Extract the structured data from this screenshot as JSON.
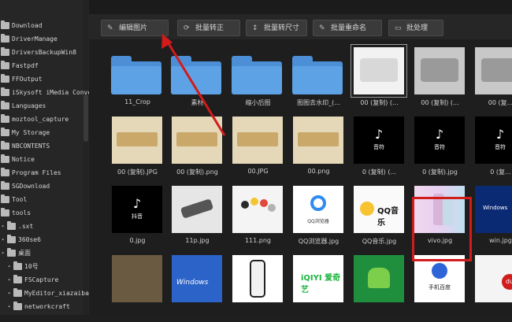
{
  "sidebar": {
    "items": [
      {
        "label": "Download",
        "indent": 0
      },
      {
        "label": "DriverManage",
        "indent": 0
      },
      {
        "label": "DriversBackupWin8",
        "indent": 0
      },
      {
        "label": "Fastpdf",
        "indent": 0
      },
      {
        "label": "FFOutput",
        "indent": 0
      },
      {
        "label": "iSkysoft iMedia Conve",
        "indent": 0
      },
      {
        "label": "Languages",
        "indent": 0
      },
      {
        "label": "moztool_capture",
        "indent": 0
      },
      {
        "label": "My Storage",
        "indent": 0
      },
      {
        "label": "NBCONTENTS",
        "indent": 0
      },
      {
        "label": "Notice",
        "indent": 0
      },
      {
        "label": "Program Files",
        "indent": 0
      },
      {
        "label": "SGDownload",
        "indent": 0
      },
      {
        "label": "Tool",
        "indent": 0
      },
      {
        "label": "tools",
        "indent": 0
      },
      {
        "label": ".sxt",
        "indent": 1
      },
      {
        "label": "360se6",
        "indent": 1
      },
      {
        "label": "桌面",
        "indent": 1
      },
      {
        "label": "10号",
        "indent": 2
      },
      {
        "label": "FSCapture",
        "indent": 2
      },
      {
        "label": "MyEditor_xiazaiba",
        "indent": 2
      },
      {
        "label": "networkcraft",
        "indent": 2
      }
    ]
  },
  "toolbar": {
    "buttons": [
      {
        "label": "编辑图片",
        "icon": "pencil-icon"
      },
      {
        "label": "批量转正",
        "icon": "rotate-icon"
      },
      {
        "label": "批量转尺寸",
        "icon": "resize-icon"
      },
      {
        "label": "批量重命名",
        "icon": "rename-icon"
      },
      {
        "label": "批处理",
        "icon": "batch-icon"
      }
    ]
  },
  "grid": {
    "rows": [
      [
        {
          "caption": "11_Crop",
          "kind": "folder"
        },
        {
          "caption": "素材",
          "kind": "folder"
        },
        {
          "caption": "缩小后图",
          "kind": "folder"
        },
        {
          "caption": "图图去水印_(...",
          "kind": "folder"
        },
        {
          "caption": "00 (复制) (...",
          "kind": "pub-w",
          "selected": true
        },
        {
          "caption": "00 (复制) (...",
          "kind": "pub"
        },
        {
          "caption": "00 (复...",
          "kind": "pub"
        }
      ],
      [
        {
          "caption": "00 (复制).JPG",
          "kind": "banner"
        },
        {
          "caption": "00 (复制).png",
          "kind": "banner"
        },
        {
          "caption": "00.JPG",
          "kind": "banner"
        },
        {
          "caption": "00.png",
          "kind": "banner"
        },
        {
          "caption": "0 (复制) (...",
          "kind": "tiktok",
          "tiktok_text": "音符"
        },
        {
          "caption": "0 (复制).jpg",
          "kind": "tiktok",
          "tiktok_text": "音符"
        },
        {
          "caption": "0 (复...",
          "kind": "tiktok",
          "tiktok_text": "音符"
        }
      ],
      [
        {
          "caption": "0.jpg",
          "kind": "tiktok",
          "tiktok_text": "抖音"
        },
        {
          "caption": "11p.jpg",
          "kind": "phone"
        },
        {
          "caption": "111.png",
          "kind": "dots"
        },
        {
          "caption": "QQ浏览器.jpg",
          "kind": "qqb",
          "text": "QQ浏览器"
        },
        {
          "caption": "QQ音乐.jpg",
          "kind": "qqm",
          "text": "QQ音乐"
        },
        {
          "caption": "vivo.jpg",
          "kind": "vivo",
          "highlighted": true
        },
        {
          "caption": "win.jpg",
          "kind": "win",
          "text": "Windows"
        }
      ],
      [
        {
          "caption": "",
          "kind": "game"
        },
        {
          "caption": "",
          "kind": "xp",
          "text": "Windows"
        },
        {
          "caption": "",
          "kind": "iph"
        },
        {
          "caption": "",
          "kind": "iqy",
          "text": "iQIYI 爱奇艺"
        },
        {
          "caption": "",
          "kind": "andr"
        },
        {
          "caption": "",
          "kind": "baidu",
          "text": "手机百度"
        },
        {
          "caption": "",
          "kind": "du",
          "text": "du"
        }
      ]
    ]
  },
  "colors": {
    "highlight": "#d21b1b",
    "folder": "#4c8fd6"
  }
}
